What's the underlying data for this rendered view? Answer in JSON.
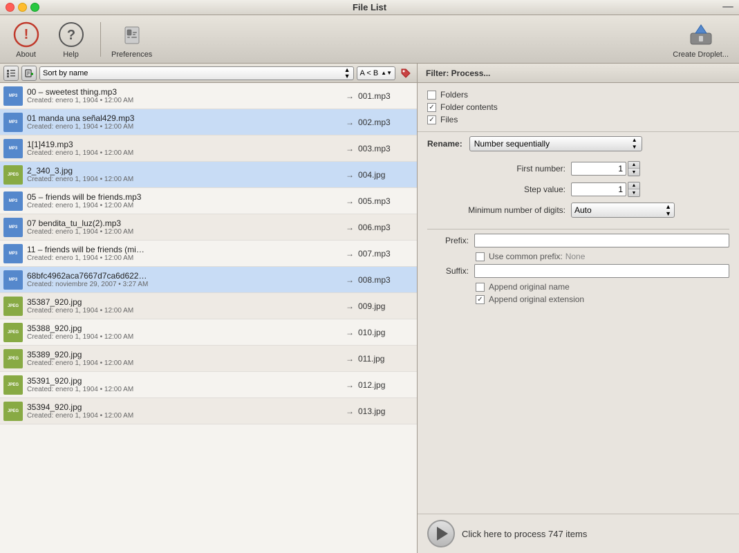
{
  "window": {
    "title": "File List"
  },
  "toolbar": {
    "about_label": "About",
    "help_label": "Help",
    "preferences_label": "Preferences",
    "create_droplet_label": "Create Droplet..."
  },
  "list_toolbar": {
    "sort_label": "Sort by name",
    "order_label": "A < B",
    "sort_placeholder": "Sort by name"
  },
  "filter": {
    "title": "Filter: Process...",
    "folders_label": "Folders",
    "folder_contents_label": "Folder contents",
    "files_label": "Files",
    "folder_contents_checked": true,
    "files_checked": true
  },
  "rename": {
    "label": "Rename:",
    "mode": "Number sequentially",
    "first_number_label": "First number:",
    "first_number_value": "1",
    "step_value_label": "Step value:",
    "step_value": "1",
    "min_digits_label": "Minimum number of digits:",
    "min_digits_value": "Auto",
    "prefix_label": "Prefix:",
    "use_common_prefix_label": "Use common prefix:",
    "none_text": "None",
    "suffix_label": "Suffix:",
    "append_original_name_label": "Append original name",
    "append_original_extension_label": "Append original extension",
    "append_original_extension_checked": true
  },
  "process": {
    "button_label": "Click here to process 747 items"
  },
  "files": [
    {
      "name": "00 – sweetest thing.mp3",
      "meta": "Created: enero 1, 1904 • 12:00 AM",
      "newname": "→ 001.mp3",
      "type": "mp3",
      "selected": false,
      "alt": false
    },
    {
      "name": "01 manda una señal429.mp3",
      "meta": "Created: enero 1, 1904 • 12:00 AM",
      "newname": "→ 002.mp3",
      "type": "mp3",
      "selected": true,
      "alt": false
    },
    {
      "name": "1[1]419.mp3",
      "meta": "Created: enero 1, 1904 • 12:00 AM",
      "newname": "→ 003.mp3",
      "type": "mp3",
      "selected": false,
      "alt": true
    },
    {
      "name": "2_340_3.jpg",
      "meta": "Created: enero 1, 1904 • 12:00 AM",
      "newname": "→ 004.jpg",
      "type": "jpg",
      "selected": true,
      "alt": false
    },
    {
      "name": "05 – friends will be friends.mp3",
      "meta": "Created: enero 1, 1904 • 12:00 AM",
      "newname": "→ 005.mp3",
      "type": "mp3",
      "selected": false,
      "alt": false
    },
    {
      "name": "07 bendita_tu_luz(2).mp3",
      "meta": "Created: enero 1, 1904 • 12:00 AM",
      "newname": "→ 006.mp3",
      "type": "mp3",
      "selected": false,
      "alt": true
    },
    {
      "name": "11 – friends will be friends (mi…",
      "meta": "Created: enero 1, 1904 • 12:00 AM",
      "newname": "→ 007.mp3",
      "type": "mp3",
      "selected": false,
      "alt": false
    },
    {
      "name": "68bfc4962aca7667d7ca6d622…",
      "meta": "Created: noviembre 29, 2007 • 3:27 AM",
      "newname": "→ 008.mp3",
      "type": "mp3",
      "selected": true,
      "alt": false
    },
    {
      "name": "35387_920.jpg",
      "meta": "Created: enero 1, 1904 • 12:00 AM",
      "newname": "→ 009.jpg",
      "type": "jpg",
      "selected": false,
      "alt": true
    },
    {
      "name": "35388_920.jpg",
      "meta": "Created: enero 1, 1904 • 12:00 AM",
      "newname": "→ 010.jpg",
      "type": "jpg",
      "selected": false,
      "alt": false
    },
    {
      "name": "35389_920.jpg",
      "meta": "Created: enero 1, 1904 • 12:00 AM",
      "newname": "→ 011.jpg",
      "type": "jpg",
      "selected": false,
      "alt": true
    },
    {
      "name": "35391_920.jpg",
      "meta": "Created: enero 1, 1904 • 12:00 AM",
      "newname": "→ 012.jpg",
      "type": "jpg",
      "selected": false,
      "alt": false
    },
    {
      "name": "35394_920.jpg",
      "meta": "Created: enero 1, 1904 • 12:00 AM",
      "newname": "→ 013.jpg",
      "type": "jpg",
      "selected": false,
      "alt": true
    }
  ]
}
